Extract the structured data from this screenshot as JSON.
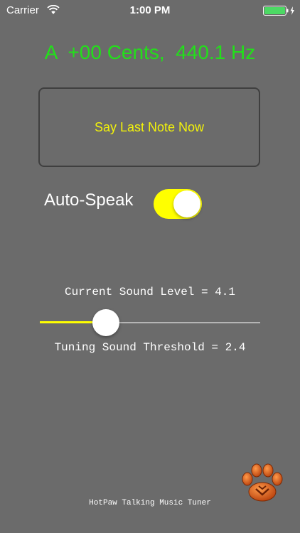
{
  "status_bar": {
    "carrier": "Carrier",
    "time": "1:00 PM",
    "wifi_icon": "wifi-icon",
    "battery_icon": "battery-charging-icon"
  },
  "tuner": {
    "readout": "A  +00 Cents,  440.1 Hz",
    "readout_color": "#22e01a",
    "say_button_label": "Say Last Note Now",
    "say_button_color": "#f2f20a"
  },
  "auto_speak": {
    "label": "Auto-Speak",
    "on": true,
    "toggle_color": "#ffff00"
  },
  "sound": {
    "level_text": "Current Sound Level = 4.1",
    "threshold_text": "Tuning Sound Threshold = 2.4",
    "slider_fraction": 0.3
  },
  "footer": {
    "title": "HotPaw Talking Music Tuner",
    "logo_icon": "paw-logo-icon"
  },
  "colors": {
    "background": "#6b6b6b",
    "logo_orange": "#e0621a"
  }
}
